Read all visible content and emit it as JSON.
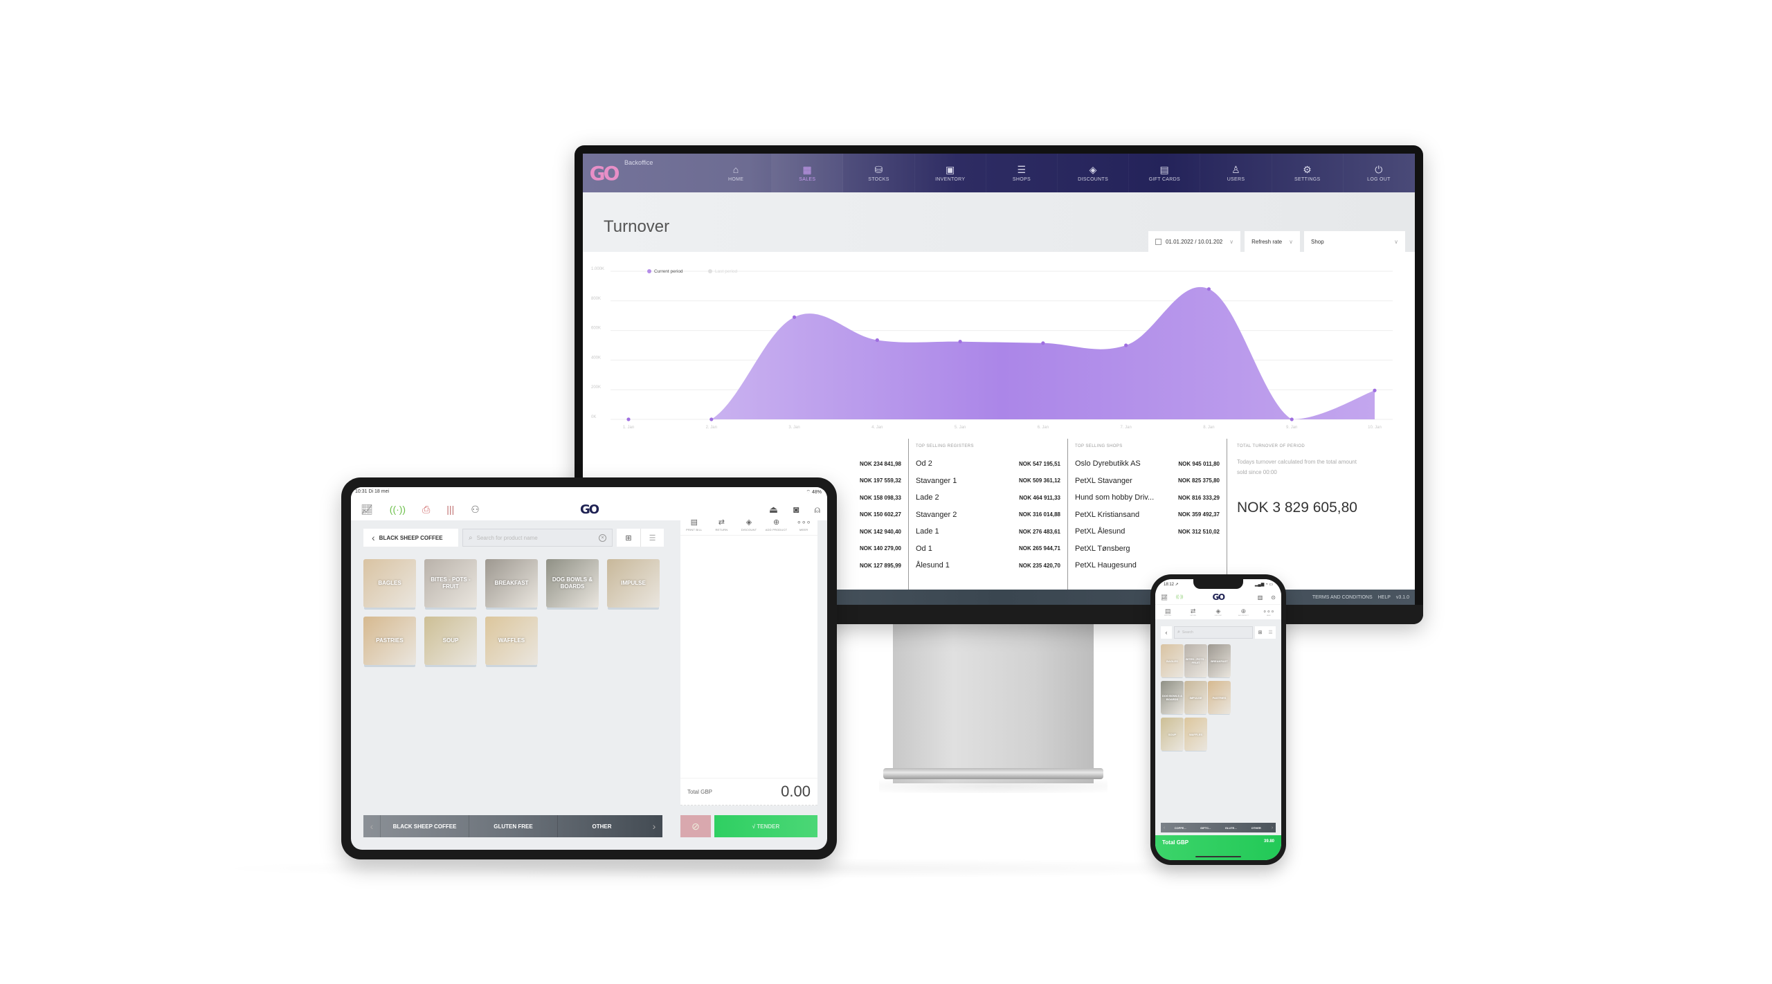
{
  "backoffice": {
    "brand": "Backoffice",
    "logo": "GO",
    "nav": [
      {
        "label": "HOME",
        "icon": "home-icon",
        "glyph": "⌂",
        "active": false
      },
      {
        "label": "SALES",
        "icon": "chart-board-icon",
        "glyph": "▦",
        "active": true
      },
      {
        "label": "STOCKS",
        "icon": "stocks-icon",
        "glyph": "⛁",
        "active": false
      },
      {
        "label": "INVENTORY",
        "icon": "box-icon",
        "glyph": "▣",
        "active": false
      },
      {
        "label": "SHOPS",
        "icon": "shop-icon",
        "glyph": "☰",
        "active": false
      },
      {
        "label": "DISCOUNTS",
        "icon": "tag-icon",
        "glyph": "◈",
        "active": false
      },
      {
        "label": "GIFT CARDS",
        "icon": "gift-card-icon",
        "glyph": "▤",
        "active": false
      },
      {
        "label": "USERS",
        "icon": "user-icon",
        "glyph": "♙",
        "active": false
      },
      {
        "label": "SETTINGS",
        "icon": "gear-icon",
        "glyph": "⚙",
        "active": false
      },
      {
        "label": "LOG OUT",
        "icon": "power-icon",
        "glyph": "⏻",
        "active": false
      }
    ],
    "page_title": "Turnover",
    "filters": {
      "date_range": "01.01.2022 / 10.01.202",
      "refresh_rate": "Refresh rate",
      "shop": "Shop"
    },
    "tables": {
      "col_a_values": [
        "NOK 234 841,98",
        "NOK 197 559,32",
        "NOK 158 098,33",
        "NOK 150 602,27",
        "NOK 142 940,40",
        "NOK 140 279,00",
        "NOK 127 895,99"
      ],
      "registers_title": "TOP SELLING REGISTERS",
      "registers": [
        {
          "name": "Od 2",
          "value": "NOK 547 195,51"
        },
        {
          "name": "Stavanger 1",
          "value": "NOK 509 361,12"
        },
        {
          "name": "Lade 2",
          "value": "NOK 464 911,33"
        },
        {
          "name": "Stavanger 2",
          "value": "NOK 316 014,88"
        },
        {
          "name": "Lade 1",
          "value": "NOK 276 483,61"
        },
        {
          "name": "Od 1",
          "value": "NOK 265 944,71"
        },
        {
          "name": "Ålesund 1",
          "value": "NOK 235 420,70"
        }
      ],
      "shops_title": "TOP SELLING SHOPS",
      "shops": [
        {
          "name": "Oslo Dyrebutikk AS",
          "value": "NOK 945 011,80"
        },
        {
          "name": "PetXL Stavanger",
          "value": "NOK 825 375,80"
        },
        {
          "name": "Hund som hobby Driv...",
          "value": "NOK 816 333,29"
        },
        {
          "name": "PetXL Kristiansand",
          "value": "NOK 359 492,37"
        },
        {
          "name": "PetXL Ålesund",
          "value": "NOK 312 510,02"
        },
        {
          "name": "PetXL Tønsberg",
          "value": ""
        },
        {
          "name": "PetXL Haugesund",
          "value": ""
        }
      ],
      "total_title": "TOTAL TURNOVER OF PERIOD",
      "total_desc": "Todays turnover calculated from the total amount sold since 00:00",
      "total_value": "NOK 3 829 605,80"
    },
    "footer": {
      "terms": "TERMS AND CONDITIONS",
      "help": "HELP",
      "version": "v3.1.0"
    }
  },
  "chart_data": {
    "type": "area",
    "title": "",
    "xlabel": "",
    "ylabel": "",
    "categories": [
      "1. Jan",
      "2. Jan",
      "3. Jan",
      "4. Jan",
      "5. Jan",
      "6. Jan",
      "7. Jan",
      "8. Jan",
      "9. Jan",
      "10. Jan"
    ],
    "series": [
      {
        "name": "Current period",
        "color": "#a57ee6",
        "values": [
          0,
          0,
          690000,
          535000,
          525000,
          515000,
          500000,
          880000,
          0,
          195000
        ]
      },
      {
        "name": "Last period",
        "color": "#dddddd",
        "values": []
      }
    ],
    "yticks": [
      "0K",
      "200K",
      "400K",
      "600K",
      "800K",
      "1.000K"
    ],
    "ylim": [
      0,
      1000000
    ],
    "grid": true,
    "legend": "top-left"
  },
  "tablet": {
    "status_time": "10:31  Di 18 mei",
    "status_battery": "⌔ 48%",
    "logo": "GO",
    "back_label": "BLACK SHEEP COFFEE",
    "search_placeholder": "Search for product name",
    "tiles": [
      {
        "label": "BAGLES",
        "color": "#d9c3a2"
      },
      {
        "label": "BITES - POTS - FRUIT",
        "color": "#b9b2aa"
      },
      {
        "label": "BREAKFAST",
        "color": "#9d9890"
      },
      {
        "label": "DOG BOWLS & BOARDS",
        "color": "#8f9085"
      },
      {
        "label": "IMPULSE",
        "color": "#c8b89a"
      },
      {
        "label": "PASTRIES",
        "color": "#d6b98f"
      },
      {
        "label": "SOUP",
        "color": "#cdbf95"
      },
      {
        "label": "WAFFLES",
        "color": "#dcc69c"
      }
    ],
    "categories": [
      "BLACK SHEEP COFFEE",
      "GLUTEN FREE",
      "OTHER"
    ],
    "cart_actions": [
      {
        "label": "PRINT BILL",
        "glyph": "▤"
      },
      {
        "label": "RETURN",
        "glyph": "⇄"
      },
      {
        "label": "DISCOUNT",
        "glyph": "◈"
      },
      {
        "label": "ADD PRODUCT",
        "glyph": "⊕"
      },
      {
        "label": "MEER",
        "glyph": "∘∘∘"
      }
    ],
    "total_label": "Total GBP",
    "total_value": "0.00",
    "tender_label": "√ TENDER"
  },
  "phone": {
    "status_time": "18:12 ➚",
    "status_right": "▂▄▆ ◔ ▭",
    "logo": "GO",
    "search_placeholder": "Search",
    "tiles": [
      {
        "label": "BAGLES",
        "color": "#d9c3a2"
      },
      {
        "label": "BITES - POTS - FRUIT",
        "color": "#b9b2aa"
      },
      {
        "label": "BREAKFAST",
        "color": "#9d9890"
      },
      {
        "label": "DOG BOWLS & BOARDS",
        "color": "#8f9085"
      },
      {
        "label": "IMPULSE",
        "color": "#c8b89a"
      },
      {
        "label": "PASTRIES",
        "color": "#d6b98f"
      },
      {
        "label": "SOUP",
        "color": "#cdbf95"
      },
      {
        "label": "WAFFLES",
        "color": "#dcc69c"
      }
    ],
    "categories": [
      "COFFE...",
      "GIFTC...",
      "GLUTE...",
      "OTHER"
    ],
    "total_label": "Total GBP",
    "total_value": "39.80"
  }
}
